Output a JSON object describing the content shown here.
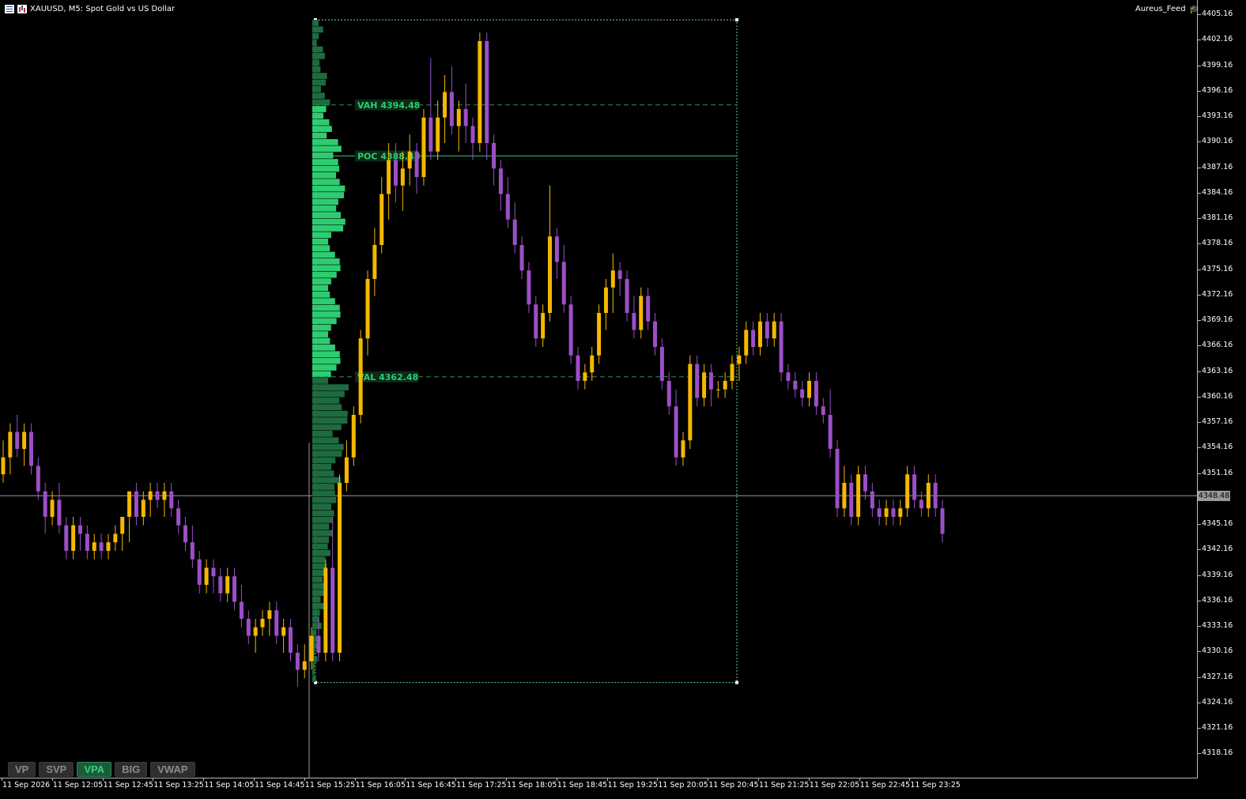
{
  "header": {
    "symbol_title": "XAUUSD, M5:  Spot Gold vs US Dollar",
    "account_label": "Aureus_Feed",
    "icons": [
      "menu-icon",
      "chart-bars-icon",
      "graduation-cap-icon"
    ]
  },
  "price_axis": {
    "labels": [
      "4405.16",
      "4402.16",
      "4399.16",
      "4396.16",
      "4393.16",
      "4390.16",
      "4387.16",
      "4384.16",
      "4381.16",
      "4378.16",
      "4375.16",
      "4372.16",
      "4369.16",
      "4366.16",
      "4363.16",
      "4360.16",
      "4357.16",
      "4354.16",
      "4351.16",
      "4348.48",
      "4345.16",
      "4342.16",
      "4339.16",
      "4336.16",
      "4333.16",
      "4330.16",
      "4327.16",
      "4324.16",
      "4321.16",
      "4318.16"
    ],
    "current_price": "4348.48"
  },
  "time_axis": {
    "labels": [
      "11 Sep 2026",
      "11 Sep 12:05",
      "11 Sep 12:45",
      "11 Sep 13:25",
      "11 Sep 14:05",
      "11 Sep 14:45",
      "11 Sep 15:25",
      "11 Sep 16:05",
      "11 Sep 16:45",
      "11 Sep 17:25",
      "11 Sep 18:05",
      "11 Sep 18:45",
      "11 Sep 19:25",
      "11 Sep 20:05",
      "11 Sep 20:45",
      "11 Sep 21:25",
      "11 Sep 22:05",
      "11 Sep 22:45",
      "11 Sep 23:25"
    ]
  },
  "volume_profile": {
    "vah_label": "VAH 4394.48",
    "poc_label": "POC 4388.48",
    "val_label": "VAL 4362.48",
    "vah": 4394.48,
    "poc": 4388.48,
    "val": 4362.48,
    "range_high": 4404.5,
    "range_low": 4326.5,
    "value_area_color": "#2ecc71",
    "outside_area_color": "#1e6b3f"
  },
  "tabs": [
    {
      "label": "VP",
      "active": false
    },
    {
      "label": "SVP",
      "active": false
    },
    {
      "label": "VPA",
      "active": true
    },
    {
      "label": "BIG",
      "active": false
    },
    {
      "label": "VWAP",
      "active": false
    }
  ],
  "colors": {
    "bull_candle": "#f5b800",
    "bear_candle": "#9b4fc6",
    "background": "#000000",
    "grid_line": "#9a9a9a"
  },
  "chart_data": {
    "type": "candlestick",
    "symbol": "XAUUSD",
    "timeframe": "M5",
    "ylim": [
      4316.5,
      4406.5
    ],
    "current_price": 4348.48,
    "candles": [
      {
        "o": 4351,
        "h": 4355,
        "l": 4350,
        "c": 4353
      },
      {
        "o": 4353,
        "h": 4357,
        "l": 4351,
        "c": 4356
      },
      {
        "o": 4356,
        "h": 4358,
        "l": 4353,
        "c": 4354
      },
      {
        "o": 4354,
        "h": 4357,
        "l": 4352,
        "c": 4356
      },
      {
        "o": 4356,
        "h": 4357,
        "l": 4351,
        "c": 4352
      },
      {
        "o": 4352,
        "h": 4353,
        "l": 4348,
        "c": 4349
      },
      {
        "o": 4349,
        "h": 4350,
        "l": 4344,
        "c": 4346
      },
      {
        "o": 4346,
        "h": 4349,
        "l": 4345,
        "c": 4348
      },
      {
        "o": 4348,
        "h": 4350,
        "l": 4344,
        "c": 4345
      },
      {
        "o": 4345,
        "h": 4346,
        "l": 4341,
        "c": 4342
      },
      {
        "o": 4342,
        "h": 4346,
        "l": 4341,
        "c": 4345
      },
      {
        "o": 4345,
        "h": 4346,
        "l": 4342,
        "c": 4344
      },
      {
        "o": 4344,
        "h": 4345,
        "l": 4341,
        "c": 4342
      },
      {
        "o": 4342,
        "h": 4344,
        "l": 4341,
        "c": 4343
      },
      {
        "o": 4343,
        "h": 4344,
        "l": 4341,
        "c": 4342
      },
      {
        "o": 4342,
        "h": 4344,
        "l": 4341,
        "c": 4343
      },
      {
        "o": 4343,
        "h": 4345,
        "l": 4342,
        "c": 4344
      },
      {
        "o": 4344,
        "h": 4346,
        "l": 4342,
        "c": 4346
      },
      {
        "o": 4346,
        "h": 4349,
        "l": 4343,
        "c": 4349
      },
      {
        "o": 4349,
        "h": 4350,
        "l": 4345,
        "c": 4346
      },
      {
        "o": 4346,
        "h": 4349,
        "l": 4345,
        "c": 4348
      },
      {
        "o": 4348,
        "h": 4350,
        "l": 4346,
        "c": 4349
      },
      {
        "o": 4349,
        "h": 4350,
        "l": 4347,
        "c": 4348
      },
      {
        "o": 4348,
        "h": 4350,
        "l": 4346,
        "c": 4349
      },
      {
        "o": 4349,
        "h": 4350,
        "l": 4346,
        "c": 4347
      },
      {
        "o": 4347,
        "h": 4348,
        "l": 4344,
        "c": 4345
      },
      {
        "o": 4345,
        "h": 4346,
        "l": 4342,
        "c": 4343
      },
      {
        "o": 4343,
        "h": 4345,
        "l": 4340,
        "c": 4341
      },
      {
        "o": 4341,
        "h": 4342,
        "l": 4337,
        "c": 4338
      },
      {
        "o": 4338,
        "h": 4341,
        "l": 4337,
        "c": 4340
      },
      {
        "o": 4340,
        "h": 4341,
        "l": 4337,
        "c": 4339
      },
      {
        "o": 4339,
        "h": 4340,
        "l": 4336,
        "c": 4337
      },
      {
        "o": 4337,
        "h": 4340,
        "l": 4336,
        "c": 4339
      },
      {
        "o": 4339,
        "h": 4340,
        "l": 4335,
        "c": 4336
      },
      {
        "o": 4336,
        "h": 4338,
        "l": 4333,
        "c": 4334
      },
      {
        "o": 4334,
        "h": 4335,
        "l": 4331,
        "c": 4332
      },
      {
        "o": 4332,
        "h": 4334,
        "l": 4330,
        "c": 4333
      },
      {
        "o": 4333,
        "h": 4335,
        "l": 4332,
        "c": 4334
      },
      {
        "o": 4334,
        "h": 4336,
        "l": 4332,
        "c": 4335
      },
      {
        "o": 4335,
        "h": 4336,
        "l": 4331,
        "c": 4332
      },
      {
        "o": 4332,
        "h": 4334,
        "l": 4330,
        "c": 4333
      },
      {
        "o": 4333,
        "h": 4334,
        "l": 4329,
        "c": 4330
      },
      {
        "o": 4330,
        "h": 4331,
        "l": 4326,
        "c": 4328
      },
      {
        "o": 4328,
        "h": 4331,
        "l": 4327,
        "c": 4329
      },
      {
        "o": 4329,
        "h": 4333,
        "l": 4328,
        "c": 4332
      },
      {
        "o": 4332,
        "h": 4334,
        "l": 4329,
        "c": 4330
      },
      {
        "o": 4330,
        "h": 4341,
        "l": 4329,
        "c": 4340
      },
      {
        "o": 4340,
        "h": 4346,
        "l": 4329,
        "c": 4330
      },
      {
        "o": 4330,
        "h": 4351,
        "l": 4329,
        "c": 4350
      },
      {
        "o": 4350,
        "h": 4355,
        "l": 4349,
        "c": 4353
      },
      {
        "o": 4353,
        "h": 4359,
        "l": 4352,
        "c": 4358
      },
      {
        "o": 4358,
        "h": 4368,
        "l": 4357,
        "c": 4367
      },
      {
        "o": 4367,
        "h": 4375,
        "l": 4365,
        "c": 4374
      },
      {
        "o": 4374,
        "h": 4380,
        "l": 4372,
        "c": 4378
      },
      {
        "o": 4378,
        "h": 4386,
        "l": 4377,
        "c": 4384
      },
      {
        "o": 4384,
        "h": 4390,
        "l": 4381,
        "c": 4388
      },
      {
        "o": 4388,
        "h": 4390,
        "l": 4383,
        "c": 4385
      },
      {
        "o": 4385,
        "h": 4389,
        "l": 4382,
        "c": 4387
      },
      {
        "o": 4387,
        "h": 4391,
        "l": 4385,
        "c": 4389
      },
      {
        "o": 4389,
        "h": 4390,
        "l": 4384,
        "c": 4386
      },
      {
        "o": 4386,
        "h": 4394,
        "l": 4385,
        "c": 4393
      },
      {
        "o": 4393,
        "h": 4400,
        "l": 4388,
        "c": 4389
      },
      {
        "o": 4389,
        "h": 4395,
        "l": 4388,
        "c": 4393
      },
      {
        "o": 4393,
        "h": 4398,
        "l": 4390,
        "c": 4396
      },
      {
        "o": 4396,
        "h": 4399,
        "l": 4391,
        "c": 4392
      },
      {
        "o": 4392,
        "h": 4395,
        "l": 4389,
        "c": 4394
      },
      {
        "o": 4394,
        "h": 4397,
        "l": 4390,
        "c": 4392
      },
      {
        "o": 4392,
        "h": 4393,
        "l": 4388,
        "c": 4390
      },
      {
        "o": 4390,
        "h": 4403,
        "l": 4389,
        "c": 4402
      },
      {
        "o": 4402,
        "h": 4403,
        "l": 4388,
        "c": 4390
      },
      {
        "o": 4390,
        "h": 4391,
        "l": 4385,
        "c": 4387
      },
      {
        "o": 4387,
        "h": 4388,
        "l": 4382,
        "c": 4384
      },
      {
        "o": 4384,
        "h": 4386,
        "l": 4380,
        "c": 4381
      },
      {
        "o": 4381,
        "h": 4383,
        "l": 4377,
        "c": 4378
      },
      {
        "o": 4378,
        "h": 4379,
        "l": 4374,
        "c": 4375
      },
      {
        "o": 4375,
        "h": 4376,
        "l": 4370,
        "c": 4371
      },
      {
        "o": 4371,
        "h": 4372,
        "l": 4366,
        "c": 4367
      },
      {
        "o": 4367,
        "h": 4371,
        "l": 4366,
        "c": 4370
      },
      {
        "o": 4370,
        "h": 4385,
        "l": 4369,
        "c": 4379
      },
      {
        "o": 4379,
        "h": 4380,
        "l": 4374,
        "c": 4376
      },
      {
        "o": 4376,
        "h": 4378,
        "l": 4370,
        "c": 4371
      },
      {
        "o": 4371,
        "h": 4372,
        "l": 4364,
        "c": 4365
      },
      {
        "o": 4365,
        "h": 4366,
        "l": 4361,
        "c": 4362
      },
      {
        "o": 4362,
        "h": 4364,
        "l": 4361,
        "c": 4363
      },
      {
        "o": 4363,
        "h": 4366,
        "l": 4362,
        "c": 4365
      },
      {
        "o": 4365,
        "h": 4371,
        "l": 4364,
        "c": 4370
      },
      {
        "o": 4370,
        "h": 4374,
        "l": 4368,
        "c": 4373
      },
      {
        "o": 4373,
        "h": 4377,
        "l": 4370,
        "c": 4375
      },
      {
        "o": 4375,
        "h": 4376,
        "l": 4372,
        "c": 4374
      },
      {
        "o": 4374,
        "h": 4375,
        "l": 4369,
        "c": 4370
      },
      {
        "o": 4370,
        "h": 4372,
        "l": 4367,
        "c": 4368
      },
      {
        "o": 4368,
        "h": 4373,
        "l": 4367,
        "c": 4372
      },
      {
        "o": 4372,
        "h": 4373,
        "l": 4368,
        "c": 4369
      },
      {
        "o": 4369,
        "h": 4370,
        "l": 4365,
        "c": 4366
      },
      {
        "o": 4366,
        "h": 4367,
        "l": 4361,
        "c": 4362
      },
      {
        "o": 4362,
        "h": 4363,
        "l": 4358,
        "c": 4359
      },
      {
        "o": 4359,
        "h": 4361,
        "l": 4352,
        "c": 4353
      },
      {
        "o": 4353,
        "h": 4356,
        "l": 4352,
        "c": 4355
      },
      {
        "o": 4355,
        "h": 4365,
        "l": 4354,
        "c": 4364
      },
      {
        "o": 4364,
        "h": 4365,
        "l": 4359,
        "c": 4360
      },
      {
        "o": 4360,
        "h": 4364,
        "l": 4359,
        "c": 4363
      },
      {
        "o": 4363,
        "h": 4364,
        "l": 4359,
        "c": 4361
      },
      {
        "o": 4361,
        "h": 4362,
        "l": 4360,
        "c": 4361
      },
      {
        "o": 4361,
        "h": 4363,
        "l": 4360,
        "c": 4362
      },
      {
        "o": 4362,
        "h": 4365,
        "l": 4361,
        "c": 4364
      },
      {
        "o": 4364,
        "h": 4366,
        "l": 4362,
        "c": 4365
      },
      {
        "o": 4365,
        "h": 4369,
        "l": 4364,
        "c": 4368
      },
      {
        "o": 4368,
        "h": 4369,
        "l": 4365,
        "c": 4366
      },
      {
        "o": 4366,
        "h": 4370,
        "l": 4365,
        "c": 4369
      },
      {
        "o": 4369,
        "h": 4370,
        "l": 4366,
        "c": 4367
      },
      {
        "o": 4367,
        "h": 4370,
        "l": 4366,
        "c": 4369
      },
      {
        "o": 4369,
        "h": 4370,
        "l": 4362,
        "c": 4363
      },
      {
        "o": 4363,
        "h": 4364,
        "l": 4361,
        "c": 4362
      },
      {
        "o": 4362,
        "h": 4363,
        "l": 4360,
        "c": 4361
      },
      {
        "o": 4361,
        "h": 4362,
        "l": 4359,
        "c": 4360
      },
      {
        "o": 4360,
        "h": 4363,
        "l": 4359,
        "c": 4362
      },
      {
        "o": 4362,
        "h": 4363,
        "l": 4358,
        "c": 4359
      },
      {
        "o": 4359,
        "h": 4360,
        "l": 4357,
        "c": 4358
      },
      {
        "o": 4358,
        "h": 4361,
        "l": 4353,
        "c": 4354
      },
      {
        "o": 4354,
        "h": 4355,
        "l": 4346,
        "c": 4347
      },
      {
        "o": 4347,
        "h": 4352,
        "l": 4346,
        "c": 4350
      },
      {
        "o": 4350,
        "h": 4351,
        "l": 4345,
        "c": 4346
      },
      {
        "o": 4346,
        "h": 4352,
        "l": 4345,
        "c": 4351
      },
      {
        "o": 4351,
        "h": 4352,
        "l": 4348,
        "c": 4349
      },
      {
        "o": 4349,
        "h": 4350,
        "l": 4346,
        "c": 4347
      },
      {
        "o": 4347,
        "h": 4348,
        "l": 4345,
        "c": 4346
      },
      {
        "o": 4346,
        "h": 4348,
        "l": 4345,
        "c": 4347
      },
      {
        "o": 4347,
        "h": 4348,
        "l": 4345,
        "c": 4346
      },
      {
        "o": 4346,
        "h": 4348,
        "l": 4345,
        "c": 4347
      },
      {
        "o": 4347,
        "h": 4352,
        "l": 4346,
        "c": 4351
      },
      {
        "o": 4351,
        "h": 4352,
        "l": 4347,
        "c": 4348
      },
      {
        "o": 4348,
        "h": 4349,
        "l": 4346,
        "c": 4347
      },
      {
        "o": 4347,
        "h": 4351,
        "l": 4346,
        "c": 4350
      },
      {
        "o": 4350,
        "h": 4351,
        "l": 4346,
        "c": 4347
      },
      {
        "o": 4347,
        "h": 4348,
        "l": 4343,
        "c": 4344
      }
    ]
  }
}
